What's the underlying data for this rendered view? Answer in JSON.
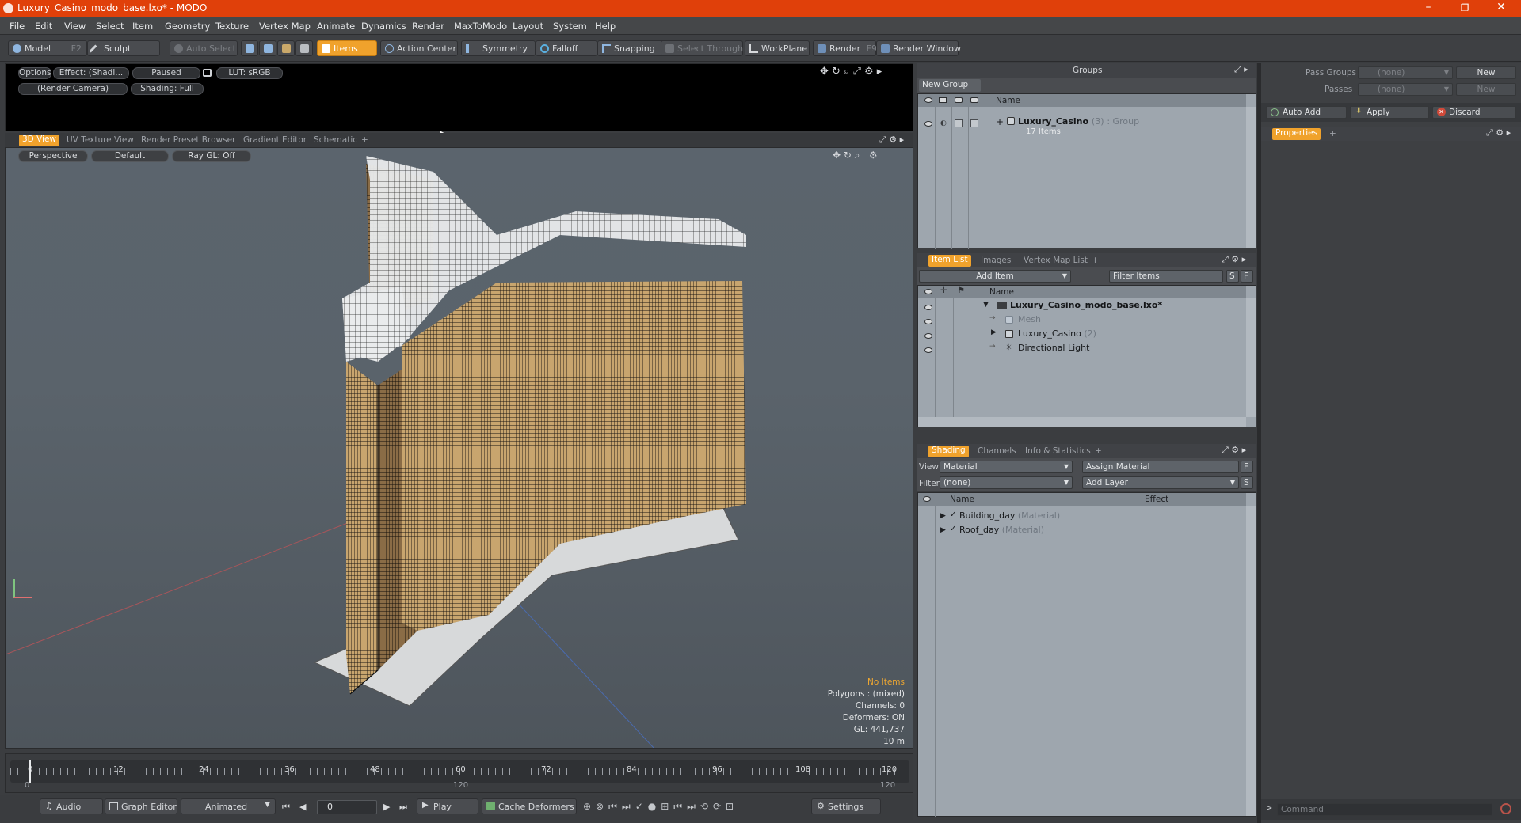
{
  "window": {
    "title": "Luxury_Casino_modo_base.lxo* - MODO",
    "controls": [
      "–",
      "❐",
      "✕"
    ]
  },
  "menu": [
    "File",
    "Edit",
    "View",
    "Select",
    "Item",
    "Geometry",
    "Texture",
    "Vertex Map",
    "Animate",
    "Dynamics",
    "Render",
    "MaxToModo",
    "Layout",
    "System",
    "Help"
  ],
  "toolbar": {
    "model": "Model",
    "model_key": "F2",
    "sculpt": "Sculpt",
    "auto_select": "Auto Select",
    "items": "Items",
    "action_center": "Action Center",
    "symmetry": "Symmetry",
    "falloff": "Falloff",
    "snapping": "Snapping",
    "select_through": "Select Through",
    "workplane": "WorkPlane",
    "render": "Render",
    "render_key": "F9",
    "render_window": "Render Window"
  },
  "preview": {
    "options": "Options",
    "effect": "Effect: (Shadi...",
    "paused": "Paused",
    "lut": "LUT: sRGB",
    "camera": "(Render Camera)",
    "shading": "Shading: Full"
  },
  "view_tabs": [
    "3D View",
    "UV Texture View",
    "Render Preset Browser",
    "Gradient Editor",
    "Schematic",
    "+"
  ],
  "viewport": {
    "perspective": "Perspective",
    "default": "Default",
    "raygl": "Ray GL: Off",
    "stats": {
      "selection": "No Items",
      "polygons": "Polygons : (mixed)",
      "channels": "Channels: 0",
      "deformers": "Deformers: ON",
      "gl": "GL: 441,737",
      "scale": "10 m"
    }
  },
  "timeline": {
    "ticks": [
      "0",
      "12",
      "24",
      "36",
      "48",
      "60",
      "72",
      "84",
      "96",
      "108",
      "120"
    ],
    "lower": [
      "0",
      "120",
      "120"
    ]
  },
  "bottom": {
    "audio": "Audio",
    "graph_editor": "Graph Editor",
    "animated": "Animated",
    "frame": "0",
    "play": "Play",
    "cache": "Cache Deformers",
    "settings": "Settings"
  },
  "groups": {
    "title": "Groups",
    "new_group": "New Group",
    "col_name": "Name",
    "row": {
      "name": "Luxury_Casino",
      "count": "(3)",
      "type": ": Group",
      "items": "17 Items"
    }
  },
  "item_list": {
    "tabs": [
      "Item List",
      "Images",
      "Vertex Map List",
      "+"
    ],
    "add_item": "Add Item",
    "filter_items": "Filter Items",
    "s": "S",
    "f": "F",
    "col_name": "Name",
    "rows": [
      {
        "label": "Luxury_Casino_modo_base.lxo*",
        "count": ""
      },
      {
        "label": "Mesh",
        "count": ""
      },
      {
        "label": "Luxury_Casino",
        "count": "(2)"
      },
      {
        "label": "Directional Light",
        "count": ""
      }
    ]
  },
  "shading": {
    "tabs": [
      "Shading",
      "Channels",
      "Info & Statistics",
      "+"
    ],
    "view_label": "View",
    "view_value": "Material",
    "assign_material": "Assign Material",
    "f": "F",
    "filter_label": "Filter",
    "filter_value": "(none)",
    "add_layer": "Add Layer",
    "s": "S",
    "col_name": "Name",
    "col_effect": "Effect",
    "rows": [
      {
        "name": "Building_day",
        "type": "(Material)"
      },
      {
        "name": "Roof_day",
        "type": "(Material)"
      }
    ]
  },
  "right": {
    "pass_groups": "Pass Groups",
    "pass_groups_val": "(none)",
    "new": "New",
    "passes": "Passes",
    "passes_val": "(none)",
    "new2": "New",
    "auto_add": "Auto Add",
    "apply": "Apply",
    "discard": "Discard",
    "properties": "Properties",
    "plus": "+",
    "command": "Command"
  },
  "colors": {
    "accent": "#f0a22c",
    "titlebar": "#e0400a",
    "panel": "#9ea6ae"
  }
}
